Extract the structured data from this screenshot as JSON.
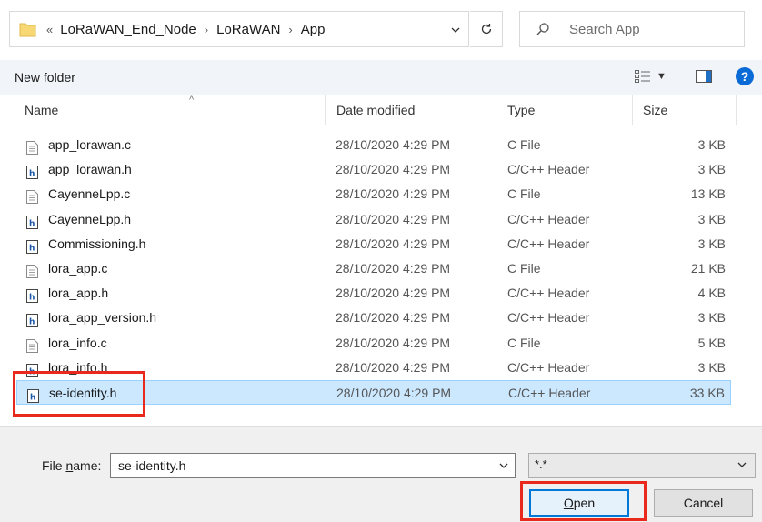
{
  "address_bar": {
    "overflow_glyph": "«",
    "crumbs": [
      "LoRaWAN_End_Node",
      "LoRaWAN",
      "App"
    ],
    "separator": "›"
  },
  "search": {
    "placeholder": "Search App"
  },
  "toolbar": {
    "new_folder_label": "New folder",
    "help_label": "?"
  },
  "columns": {
    "name": "Name",
    "date": "Date modified",
    "type": "Type",
    "size": "Size"
  },
  "files": [
    {
      "name": "app_lorawan.c",
      "date": "28/10/2020 4:29 PM",
      "type": "C File",
      "size": "3 KB",
      "icon": "c-file-icon"
    },
    {
      "name": "app_lorawan.h",
      "date": "28/10/2020 4:29 PM",
      "type": "C/C++ Header",
      "size": "3 KB",
      "icon": "header-file-icon"
    },
    {
      "name": "CayenneLpp.c",
      "date": "28/10/2020 4:29 PM",
      "type": "C File",
      "size": "13 KB",
      "icon": "c-file-icon"
    },
    {
      "name": "CayenneLpp.h",
      "date": "28/10/2020 4:29 PM",
      "type": "C/C++ Header",
      "size": "3 KB",
      "icon": "header-file-icon"
    },
    {
      "name": "Commissioning.h",
      "date": "28/10/2020 4:29 PM",
      "type": "C/C++ Header",
      "size": "3 KB",
      "icon": "header-file-icon"
    },
    {
      "name": "lora_app.c",
      "date": "28/10/2020 4:29 PM",
      "type": "C File",
      "size": "21 KB",
      "icon": "c-file-icon"
    },
    {
      "name": "lora_app.h",
      "date": "28/10/2020 4:29 PM",
      "type": "C/C++ Header",
      "size": "4 KB",
      "icon": "header-file-icon"
    },
    {
      "name": "lora_app_version.h",
      "date": "28/10/2020 4:29 PM",
      "type": "C/C++ Header",
      "size": "3 KB",
      "icon": "header-file-icon"
    },
    {
      "name": "lora_info.c",
      "date": "28/10/2020 4:29 PM",
      "type": "C File",
      "size": "5 KB",
      "icon": "c-file-icon"
    },
    {
      "name": "lora_info.h",
      "date": "28/10/2020 4:29 PM",
      "type": "C/C++ Header",
      "size": "3 KB",
      "icon": "header-file-icon"
    },
    {
      "name": "se-identity.h",
      "date": "28/10/2020 4:29 PM",
      "type": "C/C++ Header",
      "size": "33 KB",
      "icon": "header-file-icon",
      "selected": true
    }
  ],
  "footer": {
    "file_name_label_pre": "File ",
    "file_name_label_u": "n",
    "file_name_label_post": "ame:",
    "file_name_value": "se-identity.h",
    "file_type_value": "*.*",
    "open_label_u": "O",
    "open_label_rest": "pen",
    "cancel_label": "Cancel"
  },
  "colors": {
    "selection_bg": "#cce8ff",
    "selection_border": "#99d1ff",
    "highlight_red": "#e8291c",
    "primary_button_border": "#0078d7"
  }
}
